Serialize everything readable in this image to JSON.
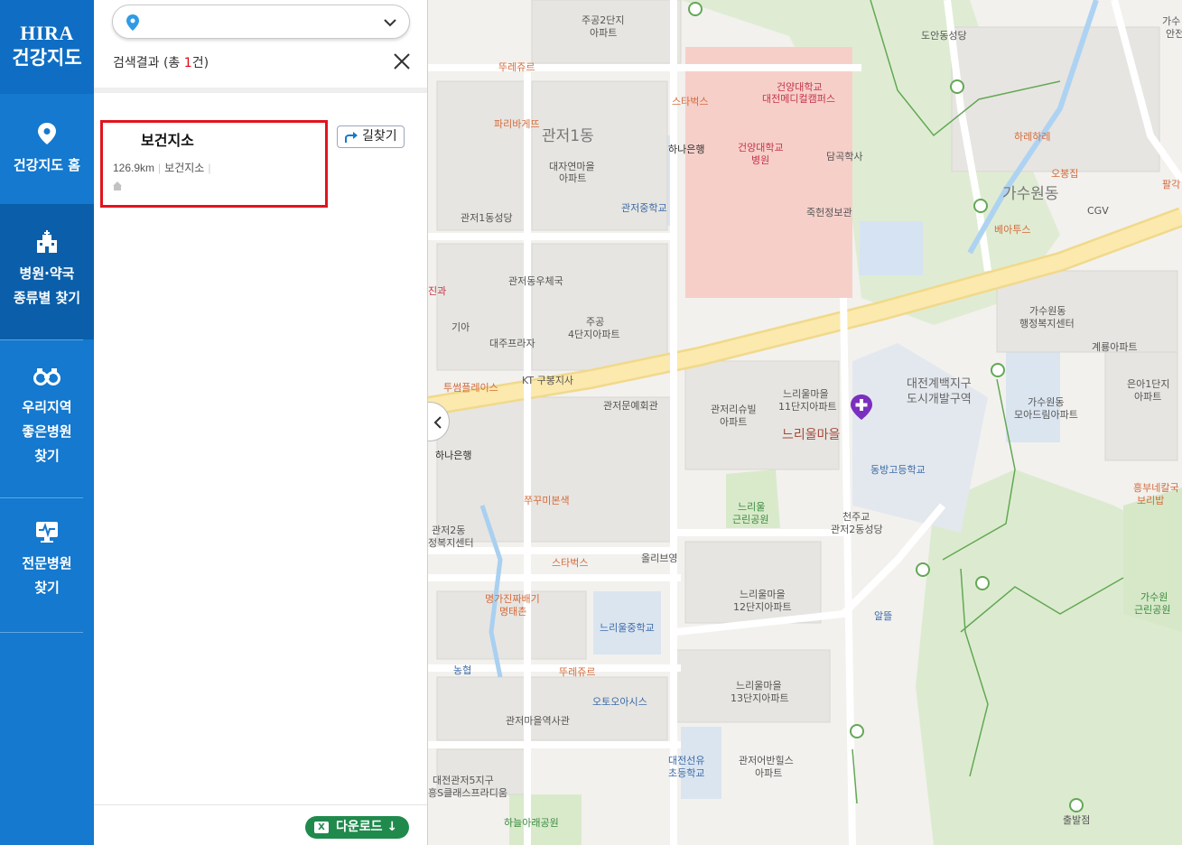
{
  "sidebar": {
    "logo_line1": "HIRA",
    "logo_line2": "건강지도",
    "items": [
      {
        "label": "건강지도 홈"
      },
      {
        "label_line1": "병원·약국",
        "label_line2": "종류별 찾기"
      },
      {
        "label_line1": "우리지역",
        "label_line2": "좋은병원",
        "label_line3": "찾기"
      },
      {
        "label_line1": "전문병원",
        "label_line2": "찾기"
      }
    ]
  },
  "panel": {
    "location_value": "",
    "result_prefix": "검색결과 (총 ",
    "result_count": "1",
    "result_suffix": "건)",
    "result": {
      "name": "보건지소",
      "distance": "126.9km",
      "category": "보건지소",
      "route_label": "길찾기"
    },
    "download_label": "다운로드 ↓"
  },
  "map": {
    "labels": {
      "l01": "주공2단지",
      "l02": "아파트",
      "l03": "뚜레쥬르",
      "l04": "파리바게뜨",
      "l05": "관저1동",
      "l06": "대자연마을",
      "l07": "아파트",
      "l08": "관저중학교",
      "l09": "관저1동성당",
      "l10": "스타벅스",
      "l11": "하나은행",
      "l12": "건양대학교",
      "l13": "대전메디컬캠퍼스",
      "l14": "건양대학교",
      "l15": "병원",
      "l16": "담곡학사",
      "l17": "죽헌정보관",
      "l18": "도안동성당",
      "l19": "하레하레",
      "l20": "오봉집",
      "l21": "가수원동",
      "l22": "CGV",
      "l23": "베아투스",
      "l24": "가수원동",
      "l25": "행정복지센터",
      "l26": "계룡아파트",
      "l27": "관저동우체국",
      "l28": "기아",
      "l29": "대주프라자",
      "l30": "주공",
      "l31": "4단지아파트",
      "l32": "KT 구봉지사",
      "l33": "투썸플레이스",
      "l34": "관저문예회관",
      "l35": "관저리슈빌",
      "l36": "아파트",
      "l37": "느리울마을",
      "l38": "11단지아파트",
      "l39": "느리울마을",
      "l40": "대전계백지구",
      "l41": "도시개발구역",
      "l42": "가수원동",
      "l43": "모아드림아파트",
      "l44": "은아1단지",
      "l45": "아파트",
      "l46": "하나은행",
      "l47": "동방고등학교",
      "l48": "쭈꾸미본색",
      "l49": "관저2동",
      "l50": "정복지센터",
      "l51": "느리울",
      "l52": "근린공원",
      "l53": "천주교",
      "l54": "관저2동성당",
      "l55": "스타벅스",
      "l56": "올리브영",
      "l57": "명가진짜배기",
      "l58": "명태촌",
      "l59": "느리울마을",
      "l60": "12단지아파트",
      "l61": "느리울중학교",
      "l62": "알뜰",
      "l63": "흥부네칼국",
      "l64": "보리밥",
      "l65": "가수원",
      "l66": "근린공원",
      "l67": "농협",
      "l68": "뚜레쥬르",
      "l69": "오토오아시스",
      "l70": "느리울마을",
      "l71": "13단지아파트",
      "l72": "관저마을역사관",
      "l73": "대전선유",
      "l74": "초등학교",
      "l75": "관저어반힐스",
      "l76": "아파트",
      "l77": "대전관저5지구",
      "l78": "흥S클래스프라디움",
      "l79": "하늘아래공원",
      "l80": "출발점",
      "l81": "팔각",
      "l82": "가수",
      "l83": "안전",
      "l84": "진과"
    }
  },
  "colors": {
    "sidebar_blue": "#1479cf",
    "sidebar_active": "#0b5faa",
    "highlight_red": "#e0141e",
    "download_green": "#1f8a4c",
    "marker_purple": "#7b2fbe"
  }
}
